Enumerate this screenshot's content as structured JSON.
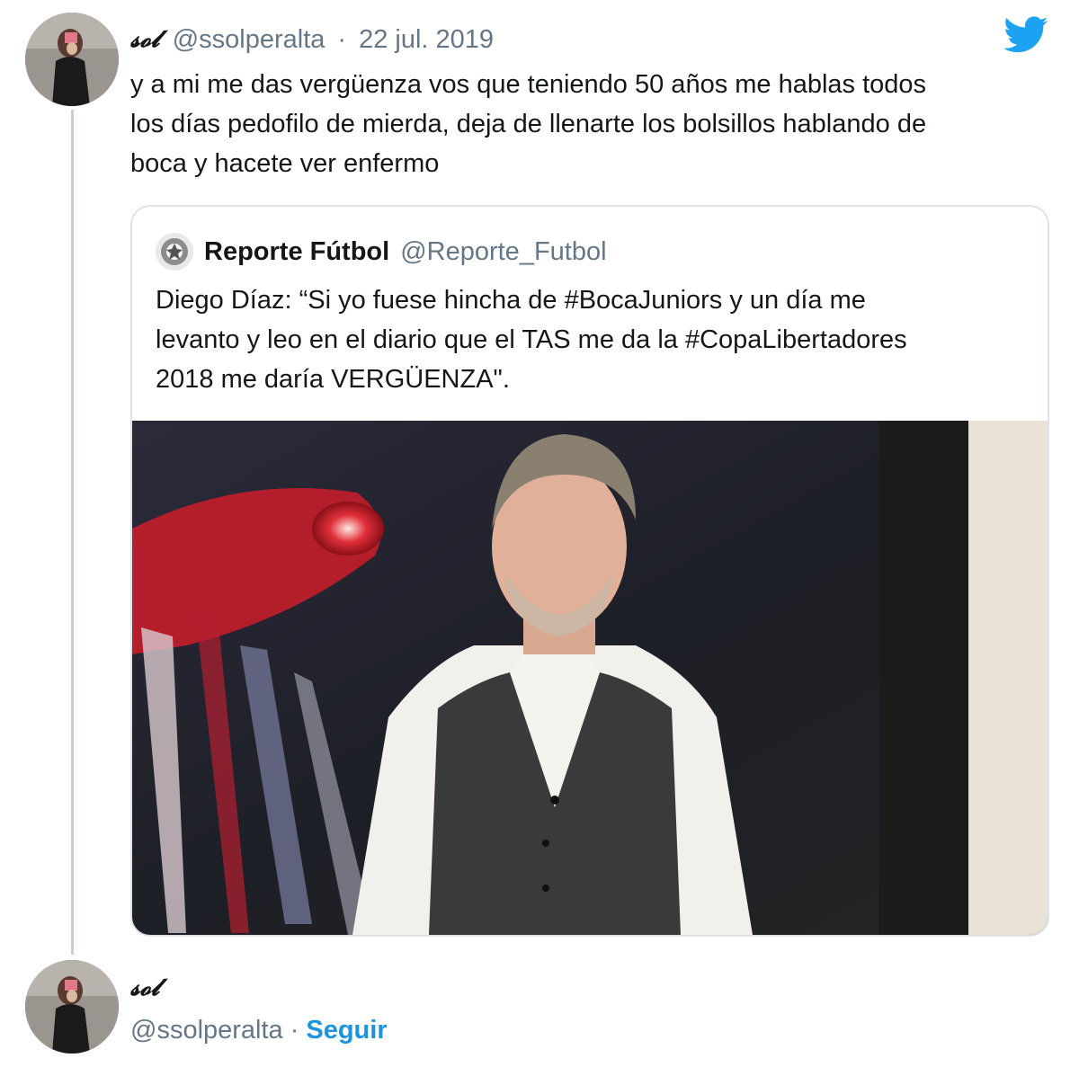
{
  "tweet": {
    "display_name": "𝓼𝓸𝓵",
    "handle": "@ssolperalta",
    "separator": "·",
    "date": "22 jul. 2019",
    "text": "y a mi me das vergüenza vos que teniendo 50 años me hablas todos\nlos días pedofilo de mierda, deja de llenarte los bolsillos hablando de\nboca y hacete ver enfermo",
    "icon": "twitter-bird-icon",
    "brand_color": "#1da1f2"
  },
  "quoted_tweet": {
    "display_name": "Reporte Fútbol",
    "handle": "@Reporte_Futbol",
    "text": "Diego Díaz: “Si yo fuese hincha de #BocaJuniors y un día me\nlevanto y leo en el diario que el TAS me da la #CopaLibertadores\n2018 me daría VERGÜENZA\".",
    "media": "photo"
  },
  "footer": {
    "display_name": "𝓼𝓸𝓵",
    "handle": "@ssolperalta",
    "separator": "·",
    "follow_label": "Seguir",
    "link_color": "#1b95e0"
  }
}
